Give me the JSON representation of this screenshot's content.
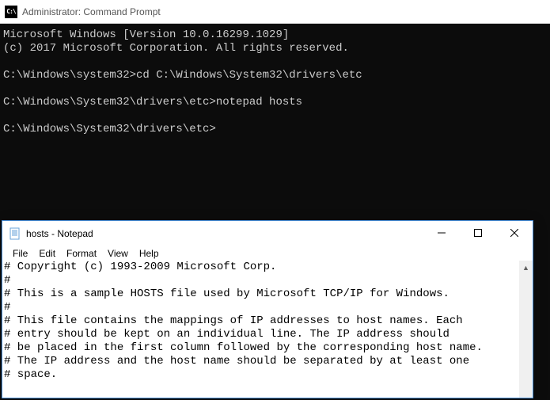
{
  "cmd": {
    "title": "Administrator: Command Prompt",
    "icon_label": "C:\\",
    "lines": [
      "Microsoft Windows [Version 10.0.16299.1029]",
      "(c) 2017 Microsoft Corporation. All rights reserved.",
      "",
      "C:\\Windows\\system32>cd C:\\Windows\\System32\\drivers\\etc",
      "",
      "C:\\Windows\\System32\\drivers\\etc>notepad hosts",
      "",
      "C:\\Windows\\System32\\drivers\\etc>"
    ]
  },
  "notepad": {
    "title": "hosts - Notepad",
    "menus": [
      "File",
      "Edit",
      "Format",
      "View",
      "Help"
    ],
    "lines": [
      "# Copyright (c) 1993-2009 Microsoft Corp.",
      "#",
      "# This is a sample HOSTS file used by Microsoft TCP/IP for Windows.",
      "#",
      "# This file contains the mappings of IP addresses to host names. Each",
      "# entry should be kept on an individual line. The IP address should",
      "# be placed in the first column followed by the corresponding host name.",
      "# The IP address and the host name should be separated by at least one",
      "# space."
    ]
  }
}
